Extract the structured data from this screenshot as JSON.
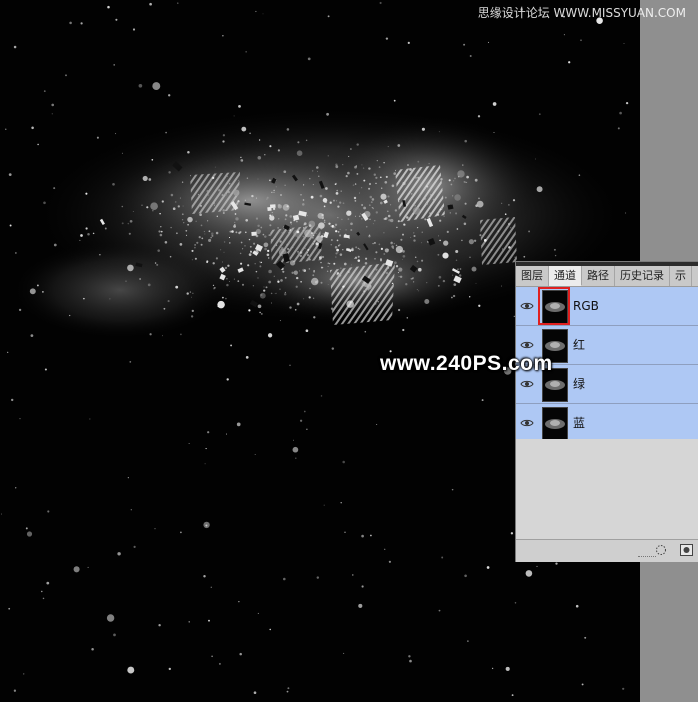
{
  "watermark": {
    "top_right": "思缘设计论坛 WWW.MISSYUAN.COM",
    "center": "www.240PS.com"
  },
  "channels_panel": {
    "tabs": [
      {
        "label": "图层",
        "active": false
      },
      {
        "label": "通道",
        "active": true
      },
      {
        "label": "路径",
        "active": false
      },
      {
        "label": "历史记录",
        "active": false
      },
      {
        "label": "示",
        "active": false
      }
    ],
    "channels": [
      {
        "label": "RGB",
        "visible": true,
        "highlighted_thumbnail": true
      },
      {
        "label": "红",
        "visible": true
      },
      {
        "label": "绿",
        "visible": true
      },
      {
        "label": "蓝",
        "visible": true
      }
    ],
    "footer": {
      "icons": [
        "load-selection-icon",
        "save-selection-icon"
      ]
    }
  },
  "colors": {
    "row_selected": "#aec8f4",
    "panel_bg": "#d6d6d6",
    "highlight_box": "#e02020",
    "side_bar": "#8f8f8f"
  }
}
